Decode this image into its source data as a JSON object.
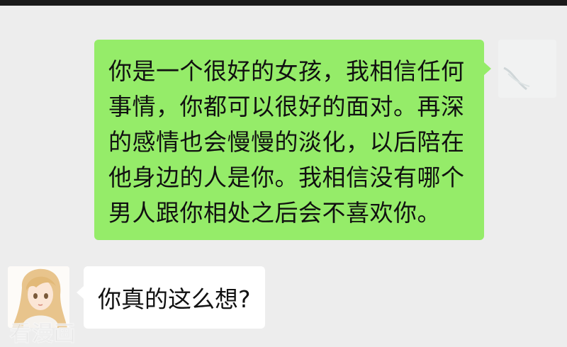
{
  "messages": [
    {
      "direction": "outgoing",
      "text": "你是一个很好的女孩，我相信任何事情，你都可以很好的面对。再深的感情也会慢慢的淡化，以后陪在他身边的人是你。我相信没有哪个男人跟你相处之后会不喜欢你。"
    },
    {
      "direction": "incoming",
      "text": "你真的这么想?"
    }
  ],
  "watermark": "看漫画",
  "colors": {
    "background": "#ededed",
    "outgoing_bubble": "#95ec69",
    "incoming_bubble": "#ffffff"
  }
}
